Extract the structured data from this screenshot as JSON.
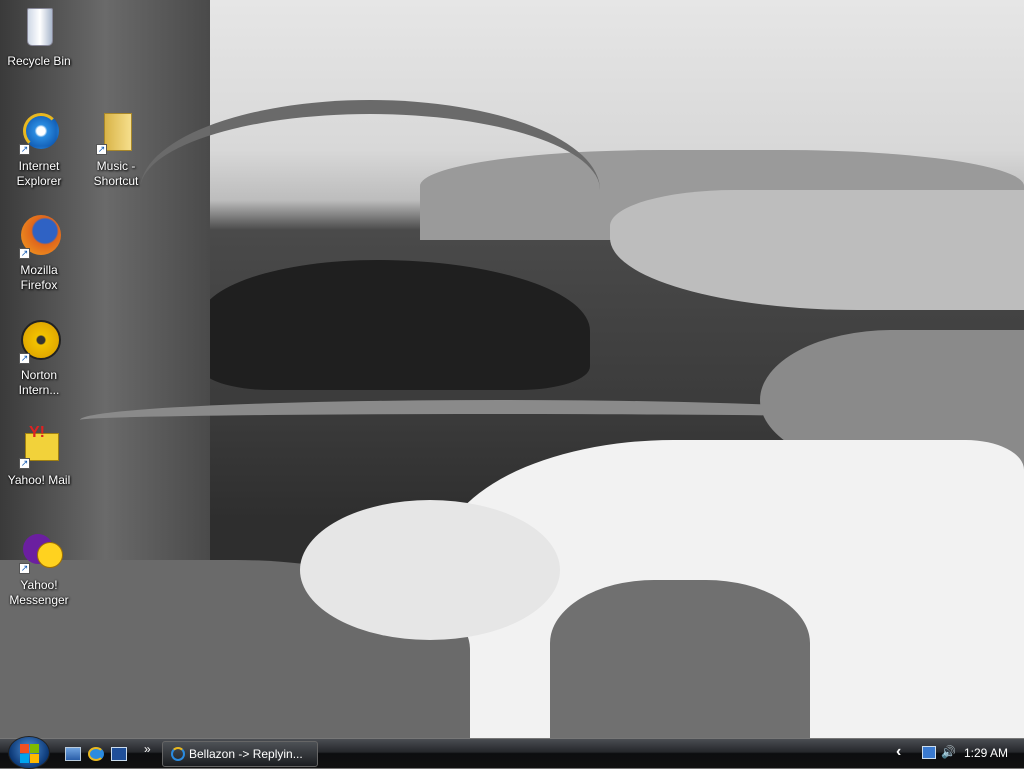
{
  "desktop_icons": [
    {
      "label": "Recycle Bin",
      "icon": "recycle-bin-icon"
    },
    {
      "label": "Internet Explorer",
      "icon": "internet-explorer-icon",
      "shortcut": true
    },
    {
      "label": "Music - Shortcut",
      "icon": "folder-icon",
      "shortcut": true
    },
    {
      "label": "Mozilla Firefox",
      "icon": "firefox-icon",
      "shortcut": true
    },
    {
      "label": "Norton Intern...",
      "icon": "norton-icon",
      "shortcut": true
    },
    {
      "label": "Yahoo! Mail",
      "icon": "yahoo-mail-icon",
      "shortcut": true
    },
    {
      "label": "Yahoo! Messenger",
      "icon": "yahoo-messenger-icon",
      "shortcut": true
    }
  ],
  "taskbar": {
    "chevron": "»",
    "task_button": "Bellazon -> Replyin...",
    "tray_expand": "‹",
    "clock": "1:29 AM"
  }
}
